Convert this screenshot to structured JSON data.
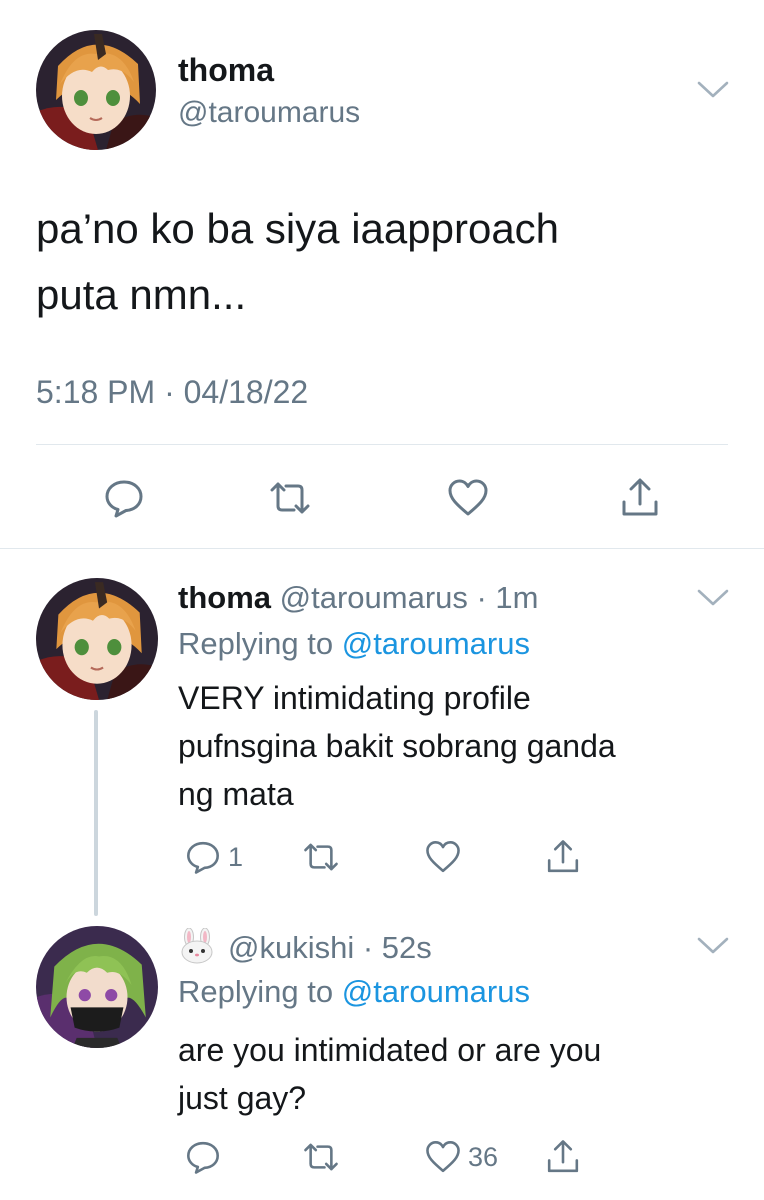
{
  "main_tweet": {
    "display_name": "thoma",
    "handle": "@taroumarus",
    "text_lines": [
      "pa’no ko ba siya iaapproach",
      "puta nmn..."
    ],
    "timestamp": "5:18 PM · 04/18/22",
    "actions": {
      "reply_icon": "reply-icon",
      "retweet_icon": "retweet-icon",
      "like_icon": "heart-icon",
      "share_icon": "share-icon"
    }
  },
  "replies": [
    {
      "display_name": "thoma",
      "handle_time": "@taroumarus · 1m",
      "replying_prefix": "Replying to",
      "replying_to": "@taroumarus",
      "text_lines": [
        "VERY intimidating profile",
        "pufnsgina bakit sobrang ganda",
        "ng mata"
      ],
      "reply_count": "1",
      "like_count": ""
    },
    {
      "display_name_emoji": "rabbit-face-emoji",
      "handle_time": "@kukishi · 52s",
      "replying_prefix": "Replying to",
      "replying_to": "@taroumarus",
      "text_lines": [
        "are you intimidated or are you",
        "just gay?"
      ],
      "reply_count": "",
      "like_count": "36"
    }
  ],
  "colors": {
    "text": "#14171a",
    "secondary": "#657786",
    "link": "#1b95e0",
    "divider": "#e1e8ed",
    "thread_line": "#ccd6dd"
  }
}
